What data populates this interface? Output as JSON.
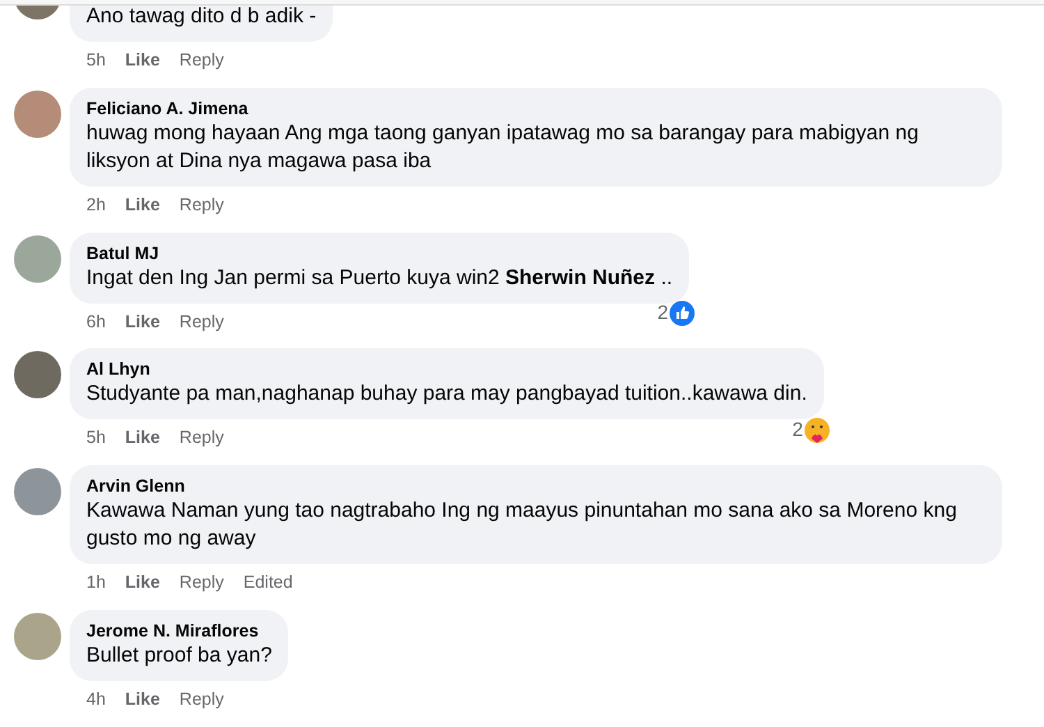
{
  "comments": [
    {
      "text": "Ano tawag dito d b adik -",
      "time": "5h",
      "like": "Like",
      "reply": "Reply"
    },
    {
      "author": "Feliciano A. Jimena",
      "text": "huwag mong hayaan Ang mga taong ganyan ipatawag mo sa barangay para mabigyan ng liksyon at Dina nya magawa pasa iba",
      "time": "2h",
      "like": "Like",
      "reply": "Reply"
    },
    {
      "author": "Batul MJ",
      "text": "Ingat den Ing Jan permi sa Puerto kuya win2 **Sherwin Nuñez** ..",
      "time": "6h",
      "like": "Like",
      "reply": "Reply",
      "reactions": {
        "count": "2",
        "kind": "like"
      }
    },
    {
      "author": "Al Lhyn",
      "text": "Studyante pa man,naghanap buhay para may pangbayad tuition..kawawa din.",
      "time": "5h",
      "like": "Like",
      "reply": "Reply",
      "reactions": {
        "count": "2",
        "kind": "care"
      }
    },
    {
      "author": "Arvin Glenn",
      "text": "Kawawa Naman yung tao nagtrabaho Ing ng maayus pinuntahan mo sana ako sa Moreno kng gusto mo ng away",
      "time": "1h",
      "like": "Like",
      "reply": "Reply",
      "edited": "Edited"
    },
    {
      "author": "Jerome N. Miraflores",
      "text": "Bullet proof ba yan?",
      "time": "4h",
      "like": "Like",
      "reply": "Reply"
    }
  ]
}
